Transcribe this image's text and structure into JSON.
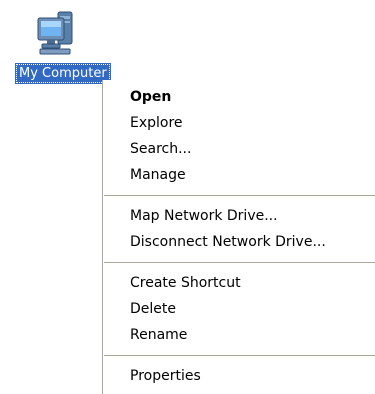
{
  "desktop": {
    "icon_label": "My Computer",
    "icon_name": "my-computer-icon"
  },
  "context_menu": {
    "groups": [
      [
        {
          "label": "Open",
          "default": true
        },
        {
          "label": "Explore"
        },
        {
          "label": "Search..."
        },
        {
          "label": "Manage"
        }
      ],
      [
        {
          "label": "Map Network Drive..."
        },
        {
          "label": "Disconnect Network Drive..."
        }
      ],
      [
        {
          "label": "Create Shortcut"
        },
        {
          "label": "Delete"
        },
        {
          "label": "Rename"
        }
      ],
      [
        {
          "label": "Properties"
        }
      ]
    ]
  },
  "colors": {
    "selection": "#316ac5",
    "separator": "#aca899",
    "menu_bg": "#ffffff"
  }
}
